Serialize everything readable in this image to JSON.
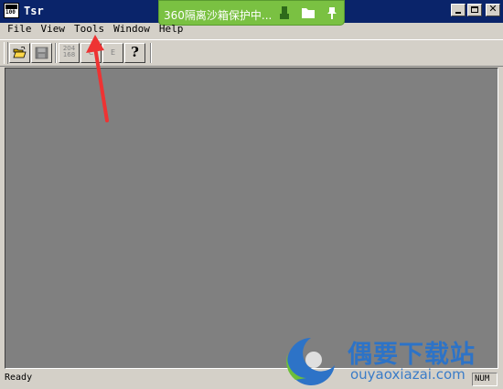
{
  "window": {
    "title": "Tsr",
    "icon_text": "100"
  },
  "sandbox_bar": {
    "text": "360隔离沙箱保护中...",
    "icons": [
      "usb-icon",
      "folder-icon",
      "pin-icon"
    ]
  },
  "menu": {
    "items": [
      "File",
      "View",
      "Tools",
      "Window",
      "Help"
    ]
  },
  "toolbar": {
    "buttons": [
      {
        "name": "open-folder-icon",
        "enabled": true
      },
      {
        "name": "save-disk-icon",
        "enabled": false
      },
      {
        "name": "convert-icon",
        "label_top": "204",
        "label_bottom": "168",
        "enabled": false
      },
      {
        "name": "c-icon",
        "label": "C",
        "enabled": false
      },
      {
        "name": "e-icon",
        "label": "E",
        "enabled": false
      },
      {
        "name": "help-icon",
        "label": "?",
        "enabled": true
      }
    ]
  },
  "status": {
    "text": "Ready",
    "indicator": "NUM"
  },
  "watermark": {
    "title": "偶要下载站",
    "url": "ouyaoxiazai.com"
  },
  "colors": {
    "titlebar": "#0a246a",
    "face": "#d4d0c8",
    "client": "#808080",
    "sandbox": "#7ac142",
    "arrow": "#ee3333",
    "watermark": "#2d73c7"
  }
}
